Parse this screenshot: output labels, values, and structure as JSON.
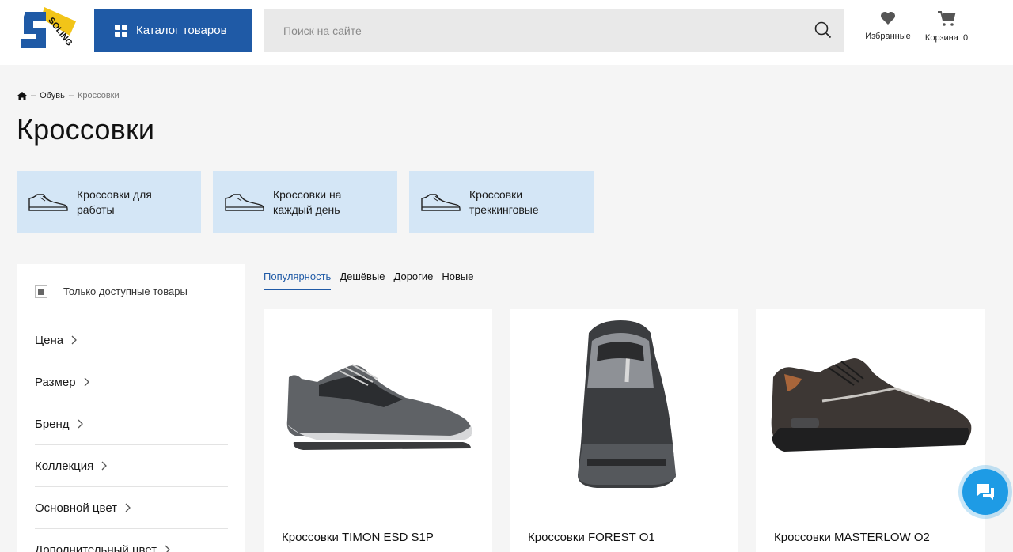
{
  "header": {
    "logo_text": "SOLING",
    "catalog_label": "Каталог товаров",
    "search_placeholder": "Поиск на сайте",
    "favorites_label": "Избранные",
    "cart_label": "Корзина",
    "cart_count": "0"
  },
  "breadcrumb": {
    "items": [
      "Обувь"
    ],
    "current": "Кроссовки"
  },
  "page_title": "Кроссовки",
  "subcategories": [
    {
      "label": "Кроссовки для работы"
    },
    {
      "label": "Кроссовки на каждый день"
    },
    {
      "label": "Кроссовки треккинговые"
    }
  ],
  "filters": {
    "available_only_label": "Только доступные товары",
    "items": [
      {
        "label": "Цена"
      },
      {
        "label": "Размер"
      },
      {
        "label": "Бренд"
      },
      {
        "label": "Коллекция"
      },
      {
        "label": "Основной цвет"
      },
      {
        "label": "Дополнительный цвет"
      }
    ]
  },
  "sort_tabs": [
    {
      "label": "Популярность",
      "active": true
    },
    {
      "label": "Дешёвые"
    },
    {
      "label": "Дорогие"
    },
    {
      "label": "Новые"
    }
  ],
  "products": [
    {
      "name": "Кроссовки TIMON ESD S1P"
    },
    {
      "name": "Кроссовки FOREST O1"
    },
    {
      "name": "Кроссовки MASTERLOW O2"
    }
  ],
  "colors": {
    "accent": "#1f5aa6",
    "subcategory_bg": "#d4e6f6",
    "chat": "#1e9be5"
  }
}
